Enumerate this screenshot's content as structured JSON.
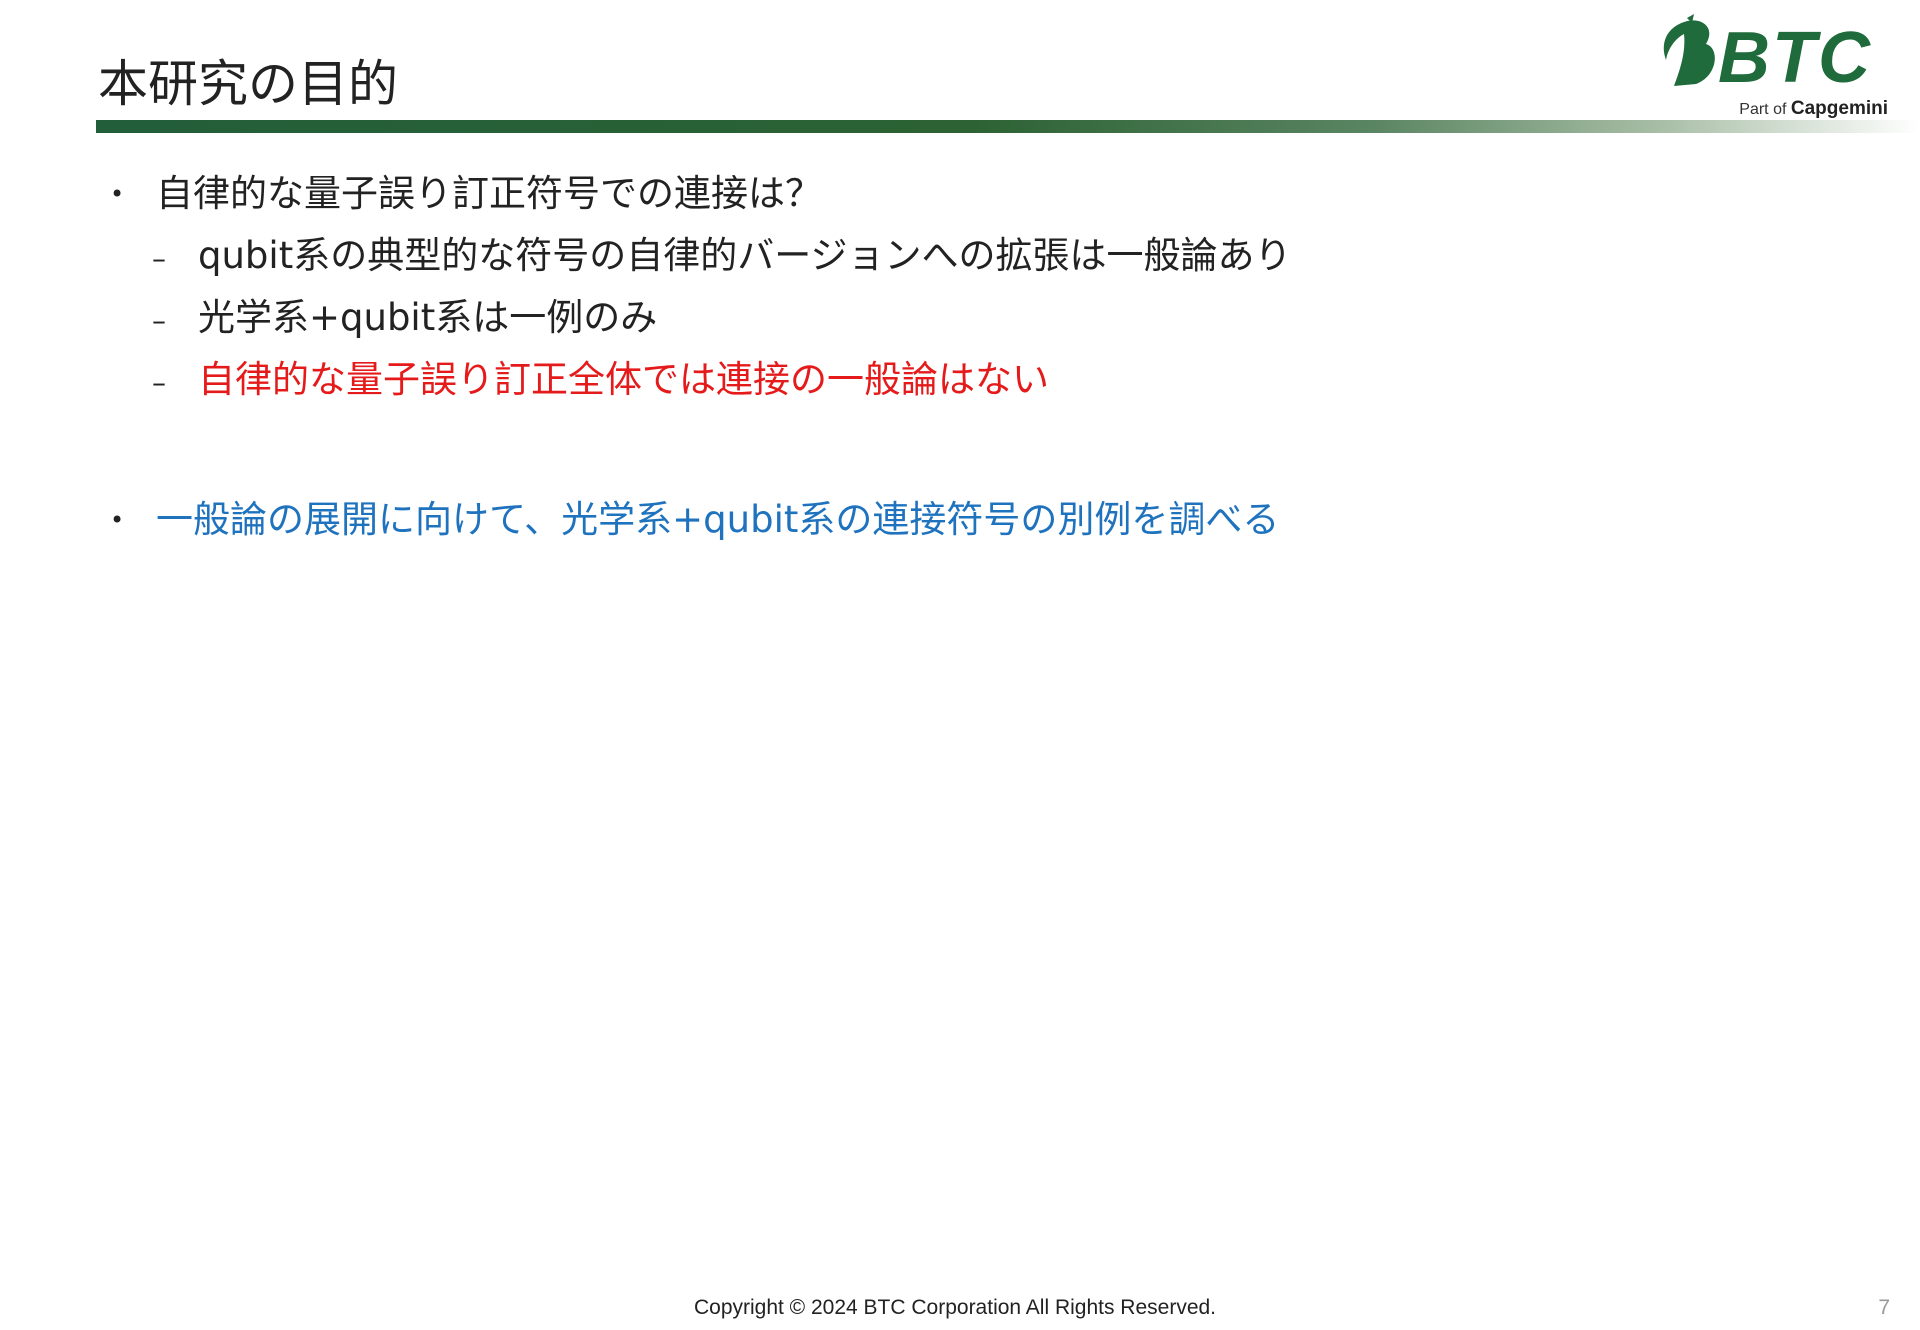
{
  "slide": {
    "title": "本研究の目的",
    "page_number": "7"
  },
  "logo": {
    "text": "BTC",
    "part_of_prefix": "Part of",
    "part_of_brand": "Capgemini",
    "color": "#1f6b3c"
  },
  "bullets": [
    {
      "level": 1,
      "marker": "•",
      "text": "自律的な量子誤り訂正符号での連接は？",
      "color": "#222222"
    },
    {
      "level": 2,
      "marker": "–",
      "text": "qubit系の典型的な符号の自律的バージョンへの拡張は一般論あり",
      "color": "#222222"
    },
    {
      "level": 2,
      "marker": "–",
      "text": "光学系+qubit系は一例のみ",
      "color": "#222222"
    },
    {
      "level": 2,
      "marker": "–",
      "text": "自律的な量子誤り訂正全体では連接の一般論はない",
      "color": "#e51b1b"
    },
    {
      "level": 1,
      "marker": "•",
      "text": "一般論の展開に向けて、光学系+qubit系の連接符号の別例を調べる",
      "color": "#1f73be"
    }
  ],
  "footer": {
    "copyright": "Copyright © 2024 BTC Corporation All Rights Reserved."
  },
  "colors": {
    "title_rule_start": "#225e3a",
    "title_rule_end": "#ffffff",
    "emphasis_red": "#e51b1b",
    "emphasis_blue": "#1f73be"
  }
}
